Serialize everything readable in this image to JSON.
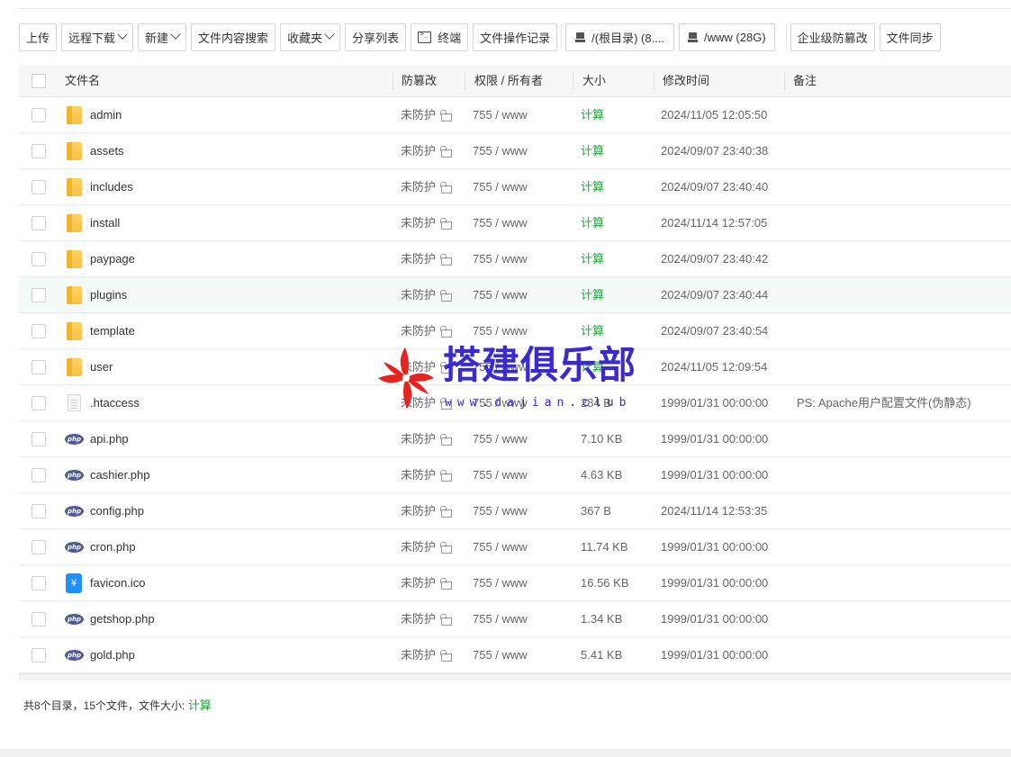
{
  "toolbar": {
    "upload": "上传",
    "remote_download": "远程下载",
    "new": "新建",
    "content_search": "文件内容搜索",
    "favorites": "收藏夹",
    "share_list": "分享列表",
    "terminal": "终端",
    "op_log": "文件操作记录",
    "root_disk": "/(根目录) (8....",
    "www_disk": "/www (28G)",
    "tamper_proof": "企业级防篡改",
    "file_sync": "文件同步"
  },
  "columns": {
    "name": "文件名",
    "tamper": "防篡改",
    "perm": "权限 / 所有者",
    "size": "大小",
    "mtime": "修改时间",
    "note": "备注"
  },
  "files": [
    {
      "type": "folder",
      "icon": "folder-icon",
      "name": "admin",
      "tamper": "未防护",
      "perm": "755 / www",
      "size": "计算",
      "mtime": "2024/11/05 12:05:50",
      "note": ""
    },
    {
      "type": "folder",
      "icon": "folder-icon",
      "name": "assets",
      "tamper": "未防护",
      "perm": "755 / www",
      "size": "计算",
      "mtime": "2024/09/07 23:40:38",
      "note": ""
    },
    {
      "type": "folder",
      "icon": "folder-icon",
      "name": "includes",
      "tamper": "未防护",
      "perm": "755 / www",
      "size": "计算",
      "mtime": "2024/09/07 23:40:40",
      "note": ""
    },
    {
      "type": "folder",
      "icon": "folder-icon",
      "name": "install",
      "tamper": "未防护",
      "perm": "755 / www",
      "size": "计算",
      "mtime": "2024/11/14 12:57:05",
      "note": ""
    },
    {
      "type": "folder",
      "icon": "folder-icon",
      "name": "paypage",
      "tamper": "未防护",
      "perm": "755 / www",
      "size": "计算",
      "mtime": "2024/09/07 23:40:42",
      "note": ""
    },
    {
      "type": "folder",
      "icon": "folder-icon",
      "name": "plugins",
      "tamper": "未防护",
      "perm": "755 / www",
      "size": "计算",
      "mtime": "2024/09/07 23:40:44",
      "note": ""
    },
    {
      "type": "folder",
      "icon": "folder-icon",
      "name": "template",
      "tamper": "未防护",
      "perm": "755 / www",
      "size": "计算",
      "mtime": "2024/09/07 23:40:54",
      "note": ""
    },
    {
      "type": "folder",
      "icon": "folder-icon",
      "name": "user",
      "tamper": "未防护",
      "perm": "755 / www",
      "size": "计算",
      "mtime": "2024/11/05 12:09:54",
      "note": ""
    },
    {
      "type": "file",
      "icon": "file-icon",
      "name": ".htaccess",
      "tamper": "未防护",
      "perm": "755 / www",
      "size": "284 B",
      "mtime": "1999/01/31 00:00:00",
      "note": "PS: Apache用户配置文件(伪静态)"
    },
    {
      "type": "php",
      "icon": "php-icon",
      "name": "api.php",
      "tamper": "未防护",
      "perm": "755 / www",
      "size": "7.10 KB",
      "mtime": "1999/01/31 00:00:00",
      "note": ""
    },
    {
      "type": "php",
      "icon": "php-icon",
      "name": "cashier.php",
      "tamper": "未防护",
      "perm": "755 / www",
      "size": "4.63 KB",
      "mtime": "1999/01/31 00:00:00",
      "note": ""
    },
    {
      "type": "php",
      "icon": "php-icon",
      "name": "config.php",
      "tamper": "未防护",
      "perm": "755 / www",
      "size": "367 B",
      "mtime": "2024/11/14 12:53:35",
      "note": ""
    },
    {
      "type": "php",
      "icon": "php-icon",
      "name": "cron.php",
      "tamper": "未防护",
      "perm": "755 / www",
      "size": "11.74 KB",
      "mtime": "1999/01/31 00:00:00",
      "note": ""
    },
    {
      "type": "ico",
      "icon": "ico-file-icon",
      "name": "favicon.ico",
      "tamper": "未防护",
      "perm": "755 / www",
      "size": "16.56 KB",
      "mtime": "1999/01/31 00:00:00",
      "note": ""
    },
    {
      "type": "php",
      "icon": "php-icon",
      "name": "getshop.php",
      "tamper": "未防护",
      "perm": "755 / www",
      "size": "1.34 KB",
      "mtime": "1999/01/31 00:00:00",
      "note": ""
    },
    {
      "type": "php",
      "icon": "php-icon",
      "name": "gold.php",
      "tamper": "未防护",
      "perm": "755 / www",
      "size": "5.41 KB",
      "mtime": "1999/01/31 00:00:00",
      "note": ""
    }
  ],
  "php_icon_text": "php",
  "ico_icon_text": "¥",
  "footer": {
    "summary": "共8个目录，15个文件，文件大小: ",
    "calc": "计算"
  },
  "watermark": {
    "title": "搭建俱乐部",
    "url": "www.dajian.club"
  },
  "colors": {
    "accent_green": "#20a53a",
    "watermark_blue": "#3a2bd0",
    "watermark_red": "#e8231f"
  }
}
